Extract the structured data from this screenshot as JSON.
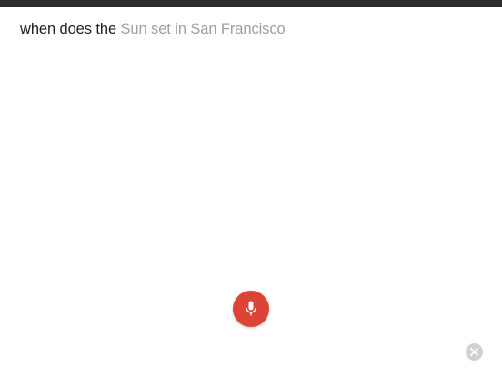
{
  "voice_search": {
    "query_final": "when does the",
    "query_partial": "Sun set in San Francisco"
  },
  "icons": {
    "mic": "microphone-icon",
    "close": "close-icon"
  },
  "colors": {
    "mic_button": "#db4437",
    "final_text": "#202124",
    "partial_text": "#9aa0a6",
    "status_bar": "#2c2c2e"
  }
}
